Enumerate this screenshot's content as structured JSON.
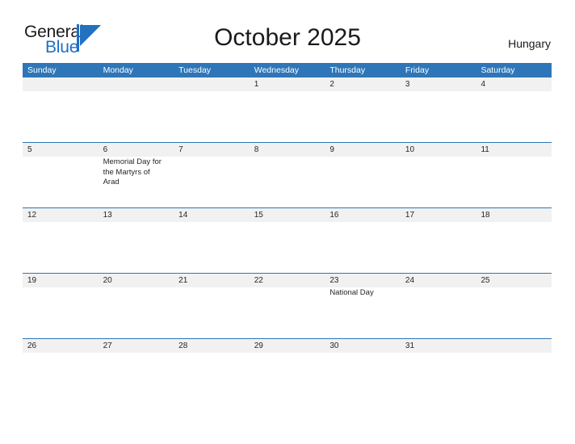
{
  "brand": {
    "name_part1": "General",
    "name_part2": "Blue",
    "mark": "triangle-logo-icon",
    "color_dark": "#1a1a1a",
    "color_blue": "#1f6fc4"
  },
  "header": {
    "title": "October 2025",
    "region": "Hungary"
  },
  "calendar": {
    "header_color": "#2e76b8",
    "band_color": "#f1f1f1",
    "weekdays": [
      "Sunday",
      "Monday",
      "Tuesday",
      "Wednesday",
      "Thursday",
      "Friday",
      "Saturday"
    ],
    "weeks": [
      {
        "days": [
          {
            "date": "",
            "event": ""
          },
          {
            "date": "",
            "event": ""
          },
          {
            "date": "",
            "event": ""
          },
          {
            "date": "1",
            "event": ""
          },
          {
            "date": "2",
            "event": ""
          },
          {
            "date": "3",
            "event": ""
          },
          {
            "date": "4",
            "event": ""
          }
        ]
      },
      {
        "days": [
          {
            "date": "5",
            "event": ""
          },
          {
            "date": "6",
            "event": "Memorial Day for the Martyrs of Arad"
          },
          {
            "date": "7",
            "event": ""
          },
          {
            "date": "8",
            "event": ""
          },
          {
            "date": "9",
            "event": ""
          },
          {
            "date": "10",
            "event": ""
          },
          {
            "date": "11",
            "event": ""
          }
        ]
      },
      {
        "days": [
          {
            "date": "12",
            "event": ""
          },
          {
            "date": "13",
            "event": ""
          },
          {
            "date": "14",
            "event": ""
          },
          {
            "date": "15",
            "event": ""
          },
          {
            "date": "16",
            "event": ""
          },
          {
            "date": "17",
            "event": ""
          },
          {
            "date": "18",
            "event": ""
          }
        ]
      },
      {
        "days": [
          {
            "date": "19",
            "event": ""
          },
          {
            "date": "20",
            "event": ""
          },
          {
            "date": "21",
            "event": ""
          },
          {
            "date": "22",
            "event": ""
          },
          {
            "date": "23",
            "event": "National Day"
          },
          {
            "date": "24",
            "event": ""
          },
          {
            "date": "25",
            "event": ""
          }
        ]
      },
      {
        "days": [
          {
            "date": "26",
            "event": ""
          },
          {
            "date": "27",
            "event": ""
          },
          {
            "date": "28",
            "event": ""
          },
          {
            "date": "29",
            "event": ""
          },
          {
            "date": "30",
            "event": ""
          },
          {
            "date": "31",
            "event": ""
          },
          {
            "date": "",
            "event": ""
          }
        ]
      }
    ]
  }
}
